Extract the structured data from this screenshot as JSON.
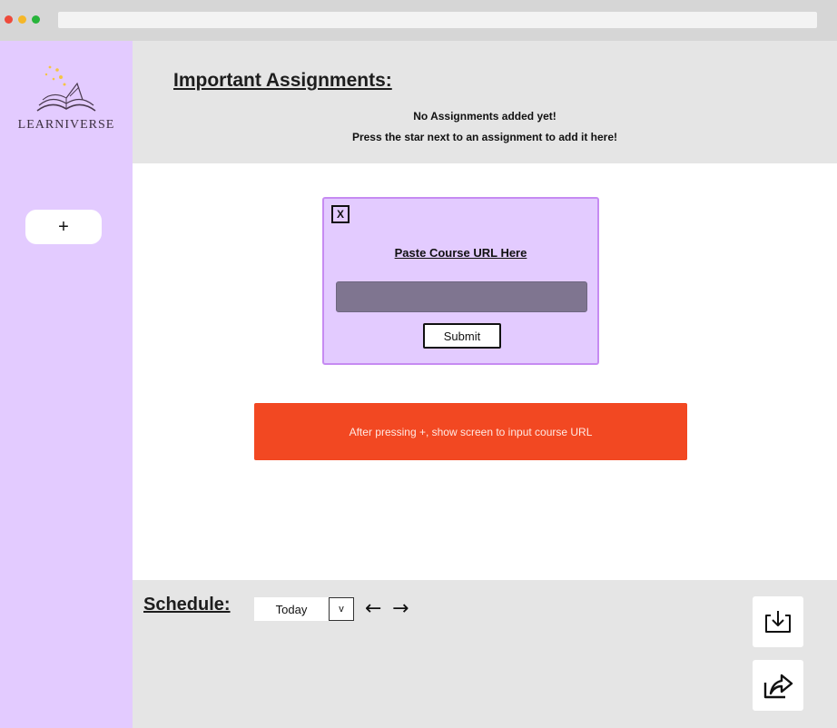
{
  "window": {
    "controls": [
      "close",
      "minimize",
      "maximize"
    ]
  },
  "sidebar": {
    "logo_text": "LEARNIVERSE",
    "add_button_label": "+"
  },
  "assignments": {
    "title": "Important Assignments:",
    "empty_line1": "No Assignments added yet!",
    "empty_line2": "Press the star next to an assignment to add it here!"
  },
  "modal": {
    "close_label": "X",
    "title": "Paste Course URL Here",
    "url_value": "",
    "submit_label": "Submit"
  },
  "annotation": {
    "text": "After pressing +, show screen to input course URL"
  },
  "schedule": {
    "title": "Schedule:",
    "selected_range": "Today",
    "dropdown_label": "v",
    "prev_label": "←",
    "next_label": "→"
  },
  "actions": {
    "import_icon": "download-tray-icon",
    "share_icon": "share-arrow-icon"
  },
  "colors": {
    "sidebar": "#e3cbff",
    "modal_border": "#c68bf2",
    "url_input": "#7f7590",
    "annotation": "#f24822",
    "panel": "#e5e5e5"
  }
}
